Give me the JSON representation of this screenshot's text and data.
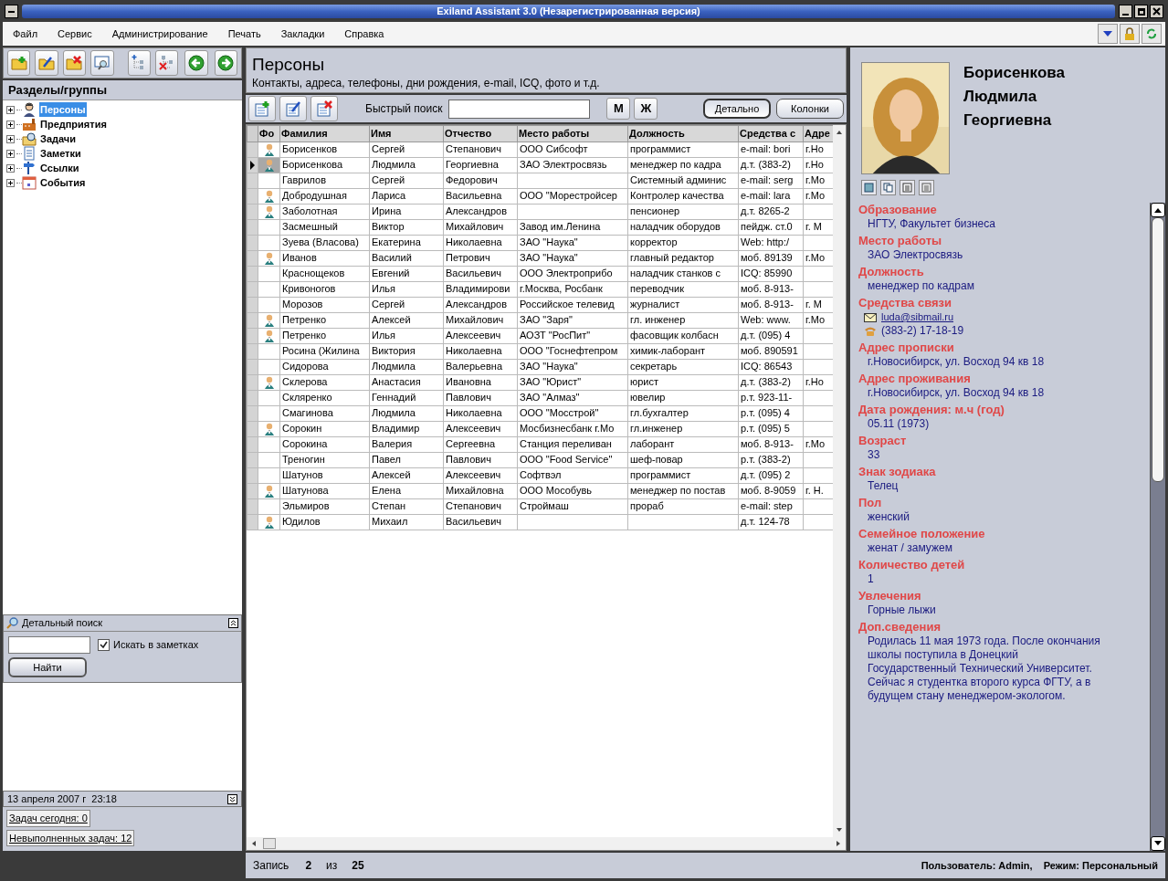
{
  "window": {
    "title": "Exiland Assistant 3.0 (Незарегистрированная версия)"
  },
  "menu": [
    "Файл",
    "Сервис",
    "Администрирование",
    "Печать",
    "Закладки",
    "Справка"
  ],
  "sections_panel": {
    "title": "Разделы/группы",
    "tree": [
      {
        "label": "Персоны",
        "selected": true,
        "expanded": false,
        "kind": "persons"
      },
      {
        "label": "Предприятия",
        "selected": false,
        "expanded": false,
        "kind": "companies"
      },
      {
        "label": "Задачи",
        "selected": false,
        "expanded": false,
        "kind": "tasks"
      },
      {
        "label": "Заметки",
        "selected": false,
        "expanded": false,
        "kind": "notes"
      },
      {
        "label": "Ссылки",
        "selected": false,
        "expanded": false,
        "kind": "links"
      },
      {
        "label": "События",
        "selected": false,
        "expanded": false,
        "kind": "events"
      }
    ]
  },
  "detailed_search": {
    "title": "Детальный поиск",
    "checkbox": {
      "label": "Искать в заметках",
      "checked": true
    },
    "button": "Найти"
  },
  "date_bar": "13 апреля 2007 г  23:18",
  "task_links": [
    "Задач сегодня: 0",
    "Невыполненных задач: 12"
  ],
  "module": {
    "title": "Персоны",
    "subtitle": "Контакты, адреса, телефоны, дни рождения, e-mail, ICQ, фото и т.д."
  },
  "quick_search": {
    "label": "Быстрый поиск"
  },
  "filter_buttons": [
    "М",
    "Ж"
  ],
  "view_buttons": [
    {
      "label": "Детально",
      "selected": true
    },
    {
      "label": "Колонки",
      "selected": false
    }
  ],
  "table": {
    "columns": [
      "Фо",
      "Фамилия",
      "Имя",
      "Отчество",
      "Место работы",
      "Должность",
      "Средства с",
      "Адре"
    ],
    "rows": [
      {
        "photo": true,
        "selected": false,
        "cells": [
          "",
          "Борисенков",
          "Сергей",
          "Степанович",
          "ООО Сибсофт",
          "программист",
          "e-mail: bori",
          "г.Но"
        ]
      },
      {
        "photo": true,
        "selected": true,
        "cells": [
          "",
          "Борисенкова",
          "Людмила",
          "Георгиевна",
          "ЗАО Электросвязь",
          "менеджер по кадра",
          "д.т. (383-2)",
          "г.Но"
        ]
      },
      {
        "photo": false,
        "selected": false,
        "cells": [
          "",
          "Гаврилов",
          "Сергей",
          "Федорович",
          "",
          "Системный админис",
          "e-mail: serg",
          "г.Мо"
        ]
      },
      {
        "photo": true,
        "selected": false,
        "cells": [
          "",
          "Добродушная",
          "Лариса",
          "Васильевна",
          "ООО \"Морестройсер",
          "Контролер качества",
          "e-mail: lara",
          "г.Мо"
        ]
      },
      {
        "photo": true,
        "selected": false,
        "cells": [
          "",
          "Заболотная",
          "Ирина",
          "Александров",
          "",
          "пенсионер",
          "д.т. 8265-2",
          ""
        ]
      },
      {
        "photo": false,
        "selected": false,
        "cells": [
          "",
          "Засмешный",
          "Виктор",
          "Михайлович",
          "Завод им.Ленина",
          "наладчик оборудов",
          "пейдж. ст.0",
          "г. М"
        ]
      },
      {
        "photo": false,
        "selected": false,
        "cells": [
          "",
          "Зуева (Власова)",
          "Екатерина",
          "Николаевна",
          "ЗАО \"Наука\"",
          "корректор",
          "Web: http:/",
          ""
        ]
      },
      {
        "photo": true,
        "selected": false,
        "cells": [
          "",
          "Иванов",
          "Василий",
          "Петрович",
          "ЗАО \"Наука\"",
          "главный редактор",
          "моб. 89139",
          "г.Мо"
        ]
      },
      {
        "photo": false,
        "selected": false,
        "cells": [
          "",
          "Краснощеков",
          "Евгений",
          "Васильевич",
          "ООО Электроприбо",
          "наладчик станков с",
          "ICQ: 85990",
          ""
        ]
      },
      {
        "photo": false,
        "selected": false,
        "cells": [
          "",
          "Кривоногов",
          "Илья",
          "Владимирови",
          "г.Москва, Росбанк",
          "переводчик",
          "моб. 8-913-",
          ""
        ]
      },
      {
        "photo": false,
        "selected": false,
        "cells": [
          "",
          "Морозов",
          "Сергей",
          "Александров",
          "Российское телевид",
          "журналист",
          "моб. 8-913-",
          "г. М"
        ]
      },
      {
        "photo": true,
        "selected": false,
        "cells": [
          "",
          "Петренко",
          "Алексей",
          "Михайлович",
          "ЗАО \"Заря\"",
          "гл. инженер",
          "Web: www.",
          "г.Мо"
        ]
      },
      {
        "photo": true,
        "selected": false,
        "cells": [
          "",
          "Петренко",
          "Илья",
          "Алексеевич",
          "АОЗТ \"РосПит\"",
          "фасовщик колбасн",
          "д.т. (095) 4",
          ""
        ]
      },
      {
        "photo": false,
        "selected": false,
        "cells": [
          "",
          "Росина (Жилина",
          "Виктория",
          "Николаевна",
          "ООО \"Госнефтепром",
          "химик-лаборант",
          "моб. 890591",
          ""
        ]
      },
      {
        "photo": false,
        "selected": false,
        "cells": [
          "",
          "Сидорова",
          "Людмила",
          "Валерьевна",
          "ЗАО \"Наука\"",
          "секретарь",
          "ICQ: 86543",
          ""
        ]
      },
      {
        "photo": true,
        "selected": false,
        "cells": [
          "",
          "Склерова",
          "Анастасия",
          "Ивановна",
          "ЗАО \"Юрист\"",
          "юрист",
          "д.т. (383-2)",
          "г.Но"
        ]
      },
      {
        "photo": false,
        "selected": false,
        "cells": [
          "",
          "Скляренко",
          "Геннадий",
          "Павлович",
          "ЗАО \"Алмаз\"",
          "ювелир",
          "р.т. 923-11-",
          ""
        ]
      },
      {
        "photo": false,
        "selected": false,
        "cells": [
          "",
          "Смагинова",
          "Людмила",
          "Николаевна",
          "ООО \"Мосстрой\"",
          "гл.бухгалтер",
          "р.т. (095) 4",
          ""
        ]
      },
      {
        "photo": true,
        "selected": false,
        "cells": [
          "",
          "Сорокин",
          "Владимир",
          "Алексеевич",
          "Мосбизнесбанк г.Мо",
          "гл.инженер",
          "р.т. (095) 5",
          ""
        ]
      },
      {
        "photo": false,
        "selected": false,
        "cells": [
          "",
          "Сорокина",
          "Валерия",
          "Сергеевна",
          "Станция переливан",
          "лаборант",
          "моб. 8-913-",
          "г.Мо"
        ]
      },
      {
        "photo": false,
        "selected": false,
        "cells": [
          "",
          "Треногин",
          "Павел",
          "Павлович",
          "ООО \"Food Service\"",
          "шеф-повар",
          "р.т. (383-2)",
          ""
        ]
      },
      {
        "photo": false,
        "selected": false,
        "cells": [
          "",
          "Шатунов",
          "Алексей",
          "Алексеевич",
          "Софтвэл",
          "программист",
          "д.т. (095) 2",
          ""
        ]
      },
      {
        "photo": true,
        "selected": false,
        "cells": [
          "",
          "Шатунова",
          "Елена",
          "Михайловна",
          "ООО Мособувь",
          "менеджер по постав",
          "моб. 8-9059",
          "г. Н."
        ]
      },
      {
        "photo": false,
        "selected": false,
        "cells": [
          "",
          "Эльмиров",
          "Степан",
          "Степанович",
          "Строймаш",
          "прораб",
          "e-mail: step",
          ""
        ]
      },
      {
        "photo": true,
        "selected": false,
        "cells": [
          "",
          "Юдилов",
          "Михаил",
          "Васильевич",
          "",
          "",
          "д.т. 124-78",
          ""
        ]
      }
    ]
  },
  "status_bar": {
    "record_label": "Запись",
    "record": "2",
    "of_label": "из",
    "total": "25",
    "user": "Пользователь: Admin,",
    "mode": "Режим: Персональный"
  },
  "details": {
    "name": [
      "Борисенкова",
      "Людмила",
      "Георгиевна"
    ],
    "fields": [
      {
        "label": "Образование",
        "values": [
          {
            "kind": "text",
            "text": "НГТУ, Факультет бизнеса"
          }
        ]
      },
      {
        "label": "Место работы",
        "values": [
          {
            "kind": "text",
            "text": "ЗАО Электросвязь"
          }
        ]
      },
      {
        "label": "Должность",
        "values": [
          {
            "kind": "text",
            "text": "менеджер по кадрам"
          }
        ]
      },
      {
        "label": "Средства связи",
        "values": [
          {
            "kind": "email",
            "text": "luda@sibmail.ru"
          },
          {
            "kind": "phone",
            "text": "(383-2) 17-18-19"
          }
        ]
      },
      {
        "label": "Адрес прописки",
        "values": [
          {
            "kind": "text",
            "text": "г.Новосибирск, ул. Восход 94 кв 18"
          }
        ]
      },
      {
        "label": "Адрес проживания",
        "values": [
          {
            "kind": "text",
            "text": "г.Новосибирск, ул. Восход 94 кв 18"
          }
        ]
      },
      {
        "label": "Дата рождения: м.ч (год)",
        "values": [
          {
            "kind": "text",
            "text": "05.11 (1973)"
          }
        ]
      },
      {
        "label": "Возраст",
        "values": [
          {
            "kind": "text",
            "text": "33"
          }
        ]
      },
      {
        "label": "Знак зодиака",
        "values": [
          {
            "kind": "text",
            "text": "Телец"
          }
        ]
      },
      {
        "label": "Пол",
        "values": [
          {
            "kind": "text",
            "text": "женский"
          }
        ]
      },
      {
        "label": "Семейное положение",
        "values": [
          {
            "kind": "text",
            "text": "женат / замужем"
          }
        ]
      },
      {
        "label": "Количество детей",
        "values": [
          {
            "kind": "text",
            "text": "1"
          }
        ]
      },
      {
        "label": "Увлечения",
        "values": [
          {
            "kind": "text",
            "text": "Горные лыжи"
          }
        ]
      },
      {
        "label": "Доп.сведения",
        "values": [
          {
            "kind": "text",
            "text": "Родилась 11 мая 1973 года. После окончания школы поступила в Донецкий Государственный Технический Университет. Сейчас я студентка второго курса ФГТУ, а в будущем стану менеджером-экологом."
          }
        ]
      }
    ]
  }
}
